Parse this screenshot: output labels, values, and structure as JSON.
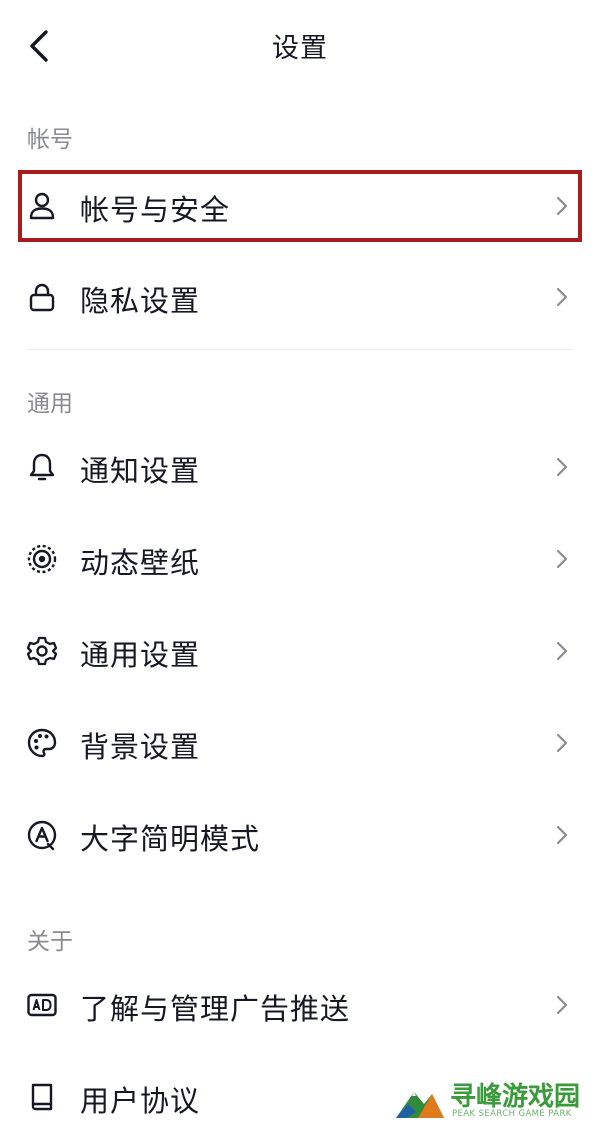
{
  "header": {
    "title": "设置"
  },
  "sections": {
    "account": {
      "title": "帐号",
      "items": [
        {
          "label": "帐号与安全",
          "icon": "person-icon"
        },
        {
          "label": "隐私设置",
          "icon": "lock-icon"
        }
      ]
    },
    "general": {
      "title": "通用",
      "items": [
        {
          "label": "通知设置",
          "icon": "bell-icon"
        },
        {
          "label": "动态壁纸",
          "icon": "live-wallpaper-icon"
        },
        {
          "label": "通用设置",
          "icon": "gear-icon"
        },
        {
          "label": "背景设置",
          "icon": "palette-icon"
        },
        {
          "label": "大字简明模式",
          "icon": "large-text-icon"
        }
      ]
    },
    "about": {
      "title": "关于",
      "items": [
        {
          "label": "了解与管理广告推送",
          "icon": "ad-icon"
        },
        {
          "label": "用户协议",
          "icon": "book-icon"
        }
      ]
    }
  },
  "highlight_color": "#a81c1c",
  "watermark": {
    "name": "寻峰游戏园",
    "tagline": "PEAK SEARCH GAME PARK",
    "color": "#3a9b3a"
  }
}
